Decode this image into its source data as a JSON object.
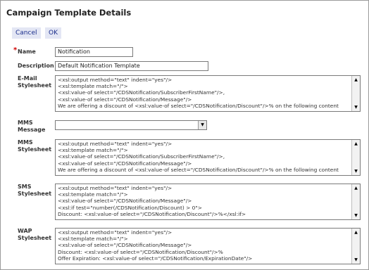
{
  "page": {
    "title": "Campaign Template Details"
  },
  "toolbar": {
    "cancel_label": "Cancel",
    "ok_label": "OK"
  },
  "form": {
    "name": {
      "label": "Name",
      "required_mark": "*",
      "value": "Notification"
    },
    "description": {
      "label": "Description",
      "value": "Default Notification Template"
    },
    "email_stylesheet": {
      "label_line1": "E-Mail",
      "label_line2": "Stylesheet",
      "lines": [
        "<xsl:output method=\"text\" indent=\"yes\"/>",
        "<xsl:template match=\"/\">",
        "<xsl:value-of select=\"/CDSNotification/SubscriberFirstName\"/>,",
        "<xsl:value-of select=\"/CDSNotification/Message\"/>",
        "We are offering a discount of <xsl:value-of select=\"/CDSNotification/Discount\"/>% on the following content"
      ]
    },
    "mms_message": {
      "label_line1": "MMS",
      "label_line2": "Message",
      "value": ""
    },
    "mms_stylesheet": {
      "label_line1": "MMS",
      "label_line2": "Stylesheet",
      "lines": [
        "<xsl:output method=\"text\" indent=\"yes\"/>",
        "<xsl:template match=\"/\">",
        "<xsl:value-of select=\"/CDSNotification/SubscriberFirstName\"/>,",
        "<xsl:value-of select=\"/CDSNotification/Message\"/>",
        "We are offering a discount of <xsl:value-of select=\"/CDSNotification/Discount\"/>% on the following content"
      ]
    },
    "sms_stylesheet": {
      "label_line1": "SMS",
      "label_line2": "Stylesheet",
      "lines": [
        "<xsl:output method=\"text\" indent=\"yes\"/>",
        "<xsl:template match=\"/\">",
        "<xsl:value-of select=\"/CDSNotification/Message\"/>",
        "<xsl:if test=\"number(/CDSNotification/Discount) > 0\">",
        "Discount: <xsl:value-of select=\"/CDSNotification/Discount\"/>%</xsl:if>"
      ]
    },
    "wap_stylesheet": {
      "label_line1": "WAP",
      "label_line2": "Stylesheet",
      "lines": [
        "<xsl:output method=\"text\" indent=\"yes\"/>",
        "<xsl:template match=\"/\">",
        "<xsl:value-of select=\"/CDSNotification/Message\"/>",
        "Discount: <xsl:value-of select=\"/CDSNotification/Discount\"/>%",
        "Offer Expiration: <xsl:value-of select=\"/CDSNotification/ExpirationDate\"/>"
      ]
    }
  },
  "icons": {
    "scroll_up": "scroll-up-arrow-icon",
    "scroll_down": "scroll-down-arrow-icon",
    "dropdown": "chevron-down-icon"
  },
  "colors": {
    "button_bg": "#e3e6f4",
    "button_text": "#1b2e8c",
    "required": "#d00000"
  }
}
